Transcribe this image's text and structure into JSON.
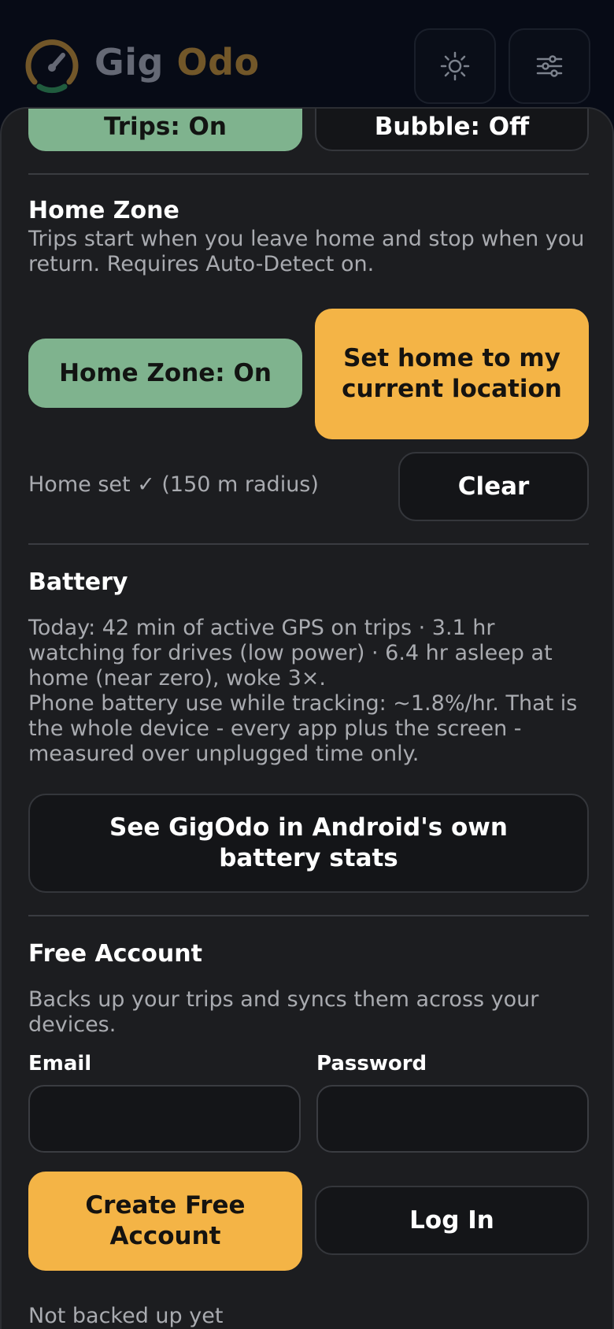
{
  "header": {
    "brand_part1": "Gig",
    "brand_part2": "Odo",
    "icons": {
      "logo": "speedometer-gauge-icon",
      "theme": "sun-icon",
      "settings": "sliders-icon"
    }
  },
  "tracking": {
    "trips_label": "Trips: On",
    "bubble_label": "Bubble: Off"
  },
  "home_zone": {
    "title": "Home Zone",
    "description": "Trips start when you leave home and stop when you return. Requires Auto-Detect on.",
    "toggle_label": "Home Zone: On",
    "set_home_label": "Set home to my current location",
    "status": "Home set ✓ (150 m radius)",
    "clear_label": "Clear"
  },
  "battery": {
    "title": "Battery",
    "today_summary": "Today: 42 min of active GPS on trips · 3.1 hr watching for drives (low power) · 6.4 hr asleep at home (near zero), woke 3×.",
    "usage_note": "Phone battery use while tracking: ~1.8%/hr. That is the whole device - every app plus the screen - measured over unplugged time only.",
    "stats_button_label": "See GigOdo in Android's own battery stats"
  },
  "account": {
    "title": "Free Account",
    "description": "Backs up your trips and syncs them across your devices.",
    "email_label": "Email",
    "email_value": "",
    "password_label": "Password",
    "password_value": "",
    "create_label": "Create Free Account",
    "login_label": "Log In",
    "status": "Not backed up yet"
  },
  "colors": {
    "accent_amber": "#f4b446",
    "accent_green": "#7fb38e",
    "background": "#1c1d20"
  }
}
